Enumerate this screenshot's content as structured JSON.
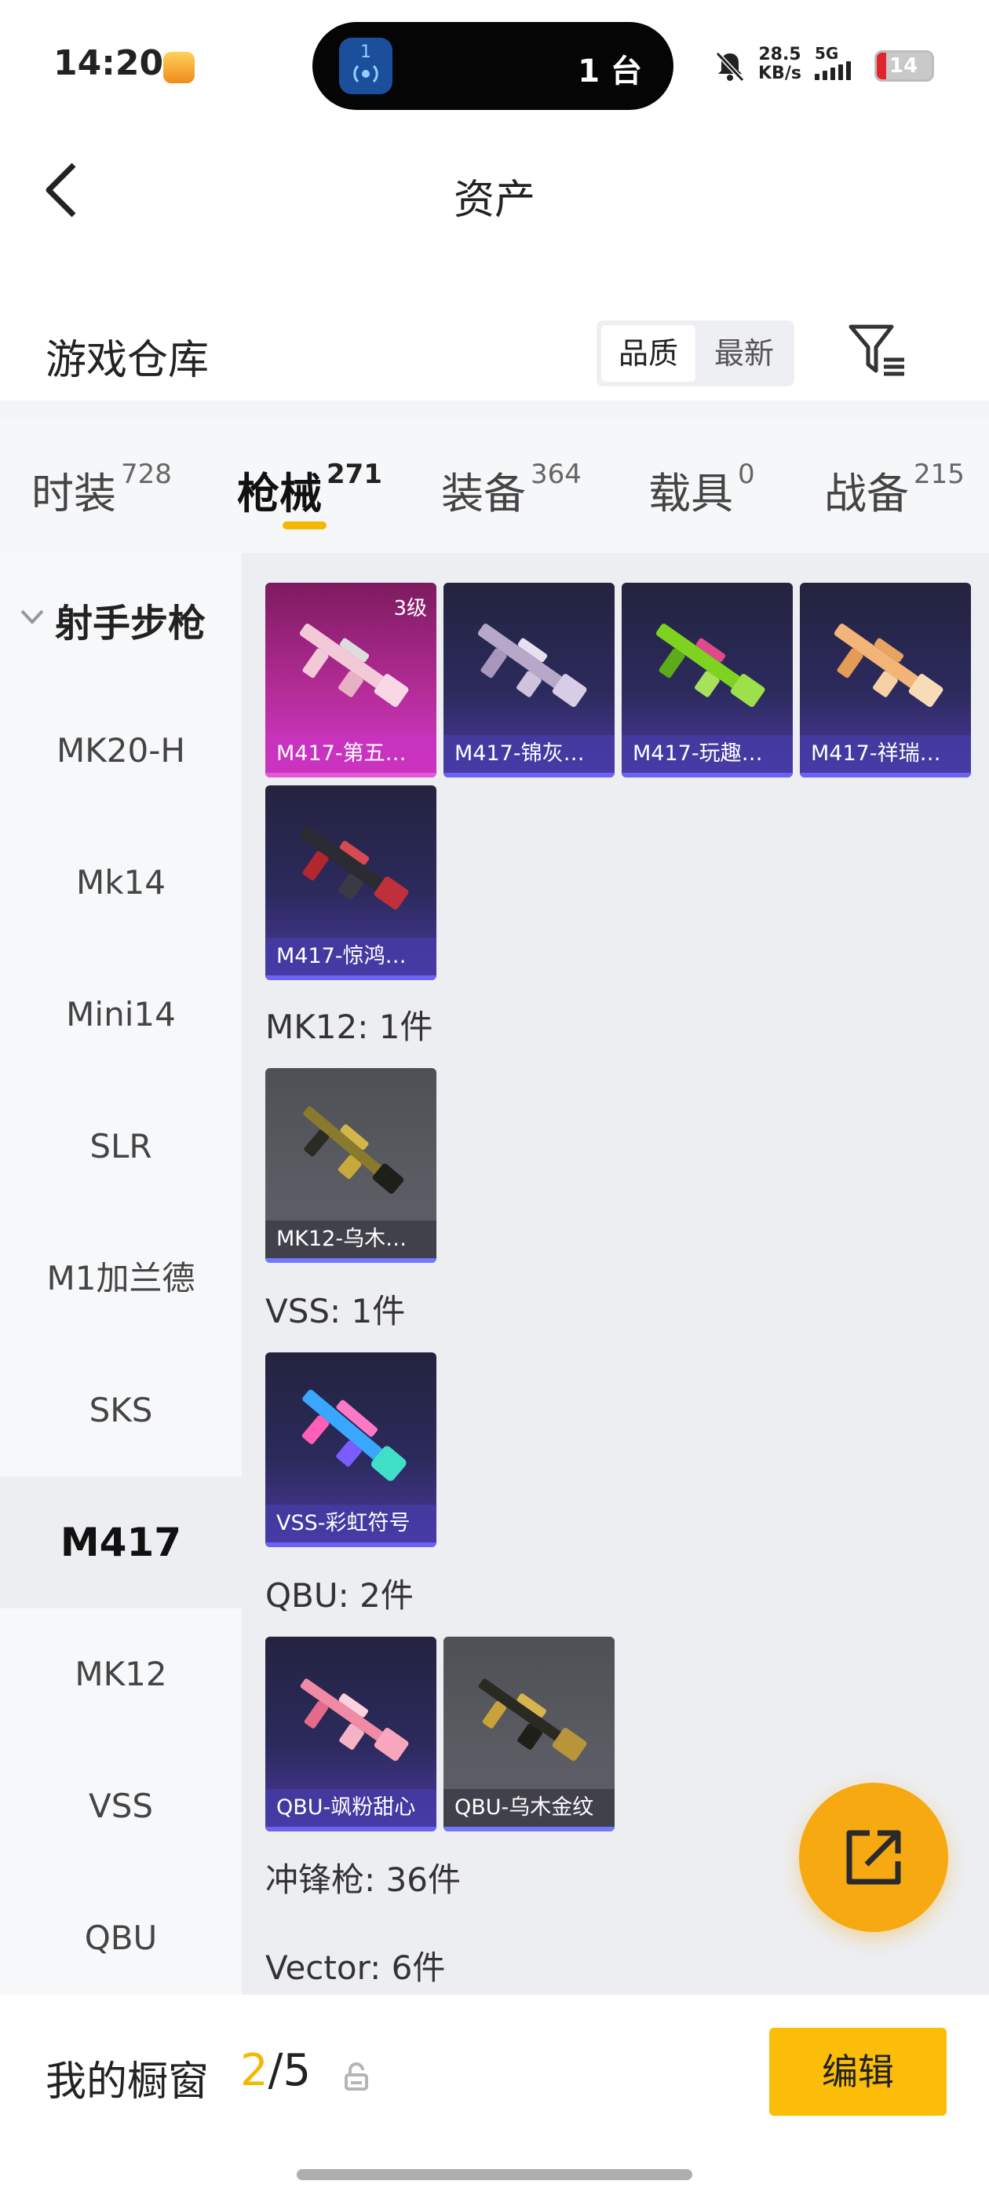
{
  "status_bar": {
    "time": "14:20",
    "island_text": "1 台",
    "island_badge": "1",
    "speed_value": "28.5",
    "speed_unit": "KB/s",
    "network": "5G",
    "battery": "14"
  },
  "header": {
    "title": "资产",
    "section_title": "游戏仓库",
    "sort_options": [
      "品质",
      "最新"
    ]
  },
  "tabs": [
    {
      "label": "时装",
      "count": "728"
    },
    {
      "label": "枪械",
      "count": "271"
    },
    {
      "label": "装备",
      "count": "364"
    },
    {
      "label": "载具",
      "count": "0"
    },
    {
      "label": "战备",
      "count": "215"
    }
  ],
  "sidebar": {
    "category": "射手步枪",
    "items": [
      "MK20-H",
      "Mk14",
      "Mini14",
      "SLR",
      "M1加兰德",
      "SKS",
      "M417",
      "MK12",
      "VSS",
      "QBU"
    ],
    "active": "M417"
  },
  "content": {
    "m417_cards": [
      {
        "name": "M417-第五…",
        "level": "3级"
      },
      {
        "name": "M417-锦灰…"
      },
      {
        "name": "M417-玩趣…"
      },
      {
        "name": "M417-祥瑞…"
      },
      {
        "name": "M417-惊鸿…"
      }
    ],
    "groups": {
      "mk12": {
        "title": "MK12: 1件",
        "cards": [
          "MK12-乌木…"
        ]
      },
      "vss": {
        "title": "VSS: 1件",
        "cards": [
          "VSS-彩虹符号"
        ]
      },
      "qbu": {
        "title": "QBU: 2件",
        "cards": [
          "QBU-飒粉甜心",
          "QBU-乌木金纹"
        ]
      },
      "smg": {
        "title": "冲锋枪: 36件"
      },
      "vector": {
        "title": "Vector: 6件"
      }
    }
  },
  "bottom_bar": {
    "showcase_label": "我的橱窗",
    "showcase_current": "2",
    "showcase_total": "/5",
    "edit_label": "编辑"
  },
  "colors": {
    "accent": "#f5b800",
    "edit_button": "#fbbd08",
    "fab": "#f6a911",
    "card_purple": "#2c2a5c",
    "card_pink": "#c531b1",
    "card_grey": "#55565c"
  },
  "icons": [
    "back-arrow-icon",
    "filter-icon",
    "chevron-down-icon",
    "share-icon",
    "lock-icon",
    "mute-bell-icon",
    "signal-icon",
    "battery-icon"
  ]
}
